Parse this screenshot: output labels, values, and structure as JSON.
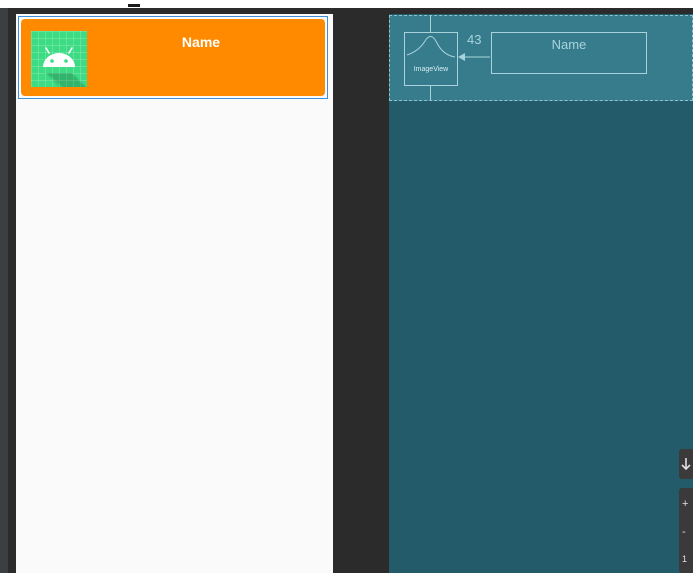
{
  "design": {
    "item_name": "Name",
    "card_color": "#ff8a00",
    "icon": "android-launcher-icon"
  },
  "blueprint": {
    "image_label": "ImageView",
    "margin_value": "43",
    "name_label": "Name",
    "panel_color": "#245b6b"
  },
  "toolbar": {
    "down_icon": "down-arrow-icon",
    "zoom_in_glyph": "+",
    "zoom_out_glyph": "-",
    "zoom_ratio_glyph": "1"
  }
}
